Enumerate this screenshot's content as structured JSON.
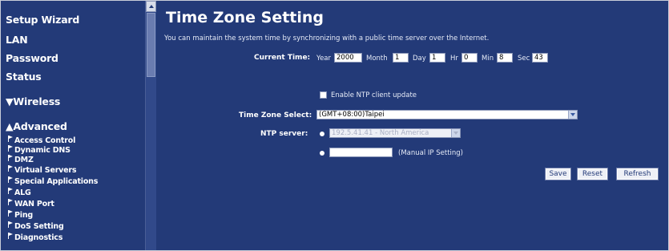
{
  "sidebar": {
    "main_items": [
      {
        "label": "Setup Wizard"
      },
      {
        "label": "LAN"
      },
      {
        "label": "Password"
      },
      {
        "label": "Status"
      }
    ],
    "wireless_label": "▼Wireless",
    "advanced_label": "▲Advanced",
    "sub_items": [
      {
        "label": "Access Control"
      },
      {
        "label": "Dynamic DNS"
      },
      {
        "label": "DMZ"
      },
      {
        "label": "Virtual Servers"
      },
      {
        "label": "Special Applications"
      },
      {
        "label": "ALG"
      },
      {
        "label": "WAN Port"
      },
      {
        "label": "Ping"
      },
      {
        "label": "DoS Setting"
      },
      {
        "label": "Diagnostics"
      }
    ]
  },
  "page": {
    "title": "Time Zone Setting",
    "description": "You can maintain the system time by synchronizing with a public time server over the Internet."
  },
  "current_time": {
    "label": "Current Time:",
    "year_label": "Year",
    "year": "2000",
    "month_label": "Month",
    "month": "1",
    "day_label": "Day",
    "day": "1",
    "hr_label": "Hr",
    "hr": "0",
    "min_label": "Min",
    "min": "8",
    "sec_label": "Sec",
    "sec": "43"
  },
  "ntp": {
    "enable_label": "Enable NTP client update",
    "enabled": false,
    "timezone_label": "Time Zone Select:",
    "timezone_value": "(GMT+08:00)Taipei",
    "server_label": "NTP server:",
    "server_value": "192.5.41.41 - North America",
    "manual_label": "(Manual IP Setting)",
    "manual_value": ""
  },
  "buttons": {
    "save": "Save",
    "reset": "Reset",
    "refresh": "Refresh"
  },
  "colors": {
    "background": "#233a78",
    "text": "#ffffff"
  }
}
